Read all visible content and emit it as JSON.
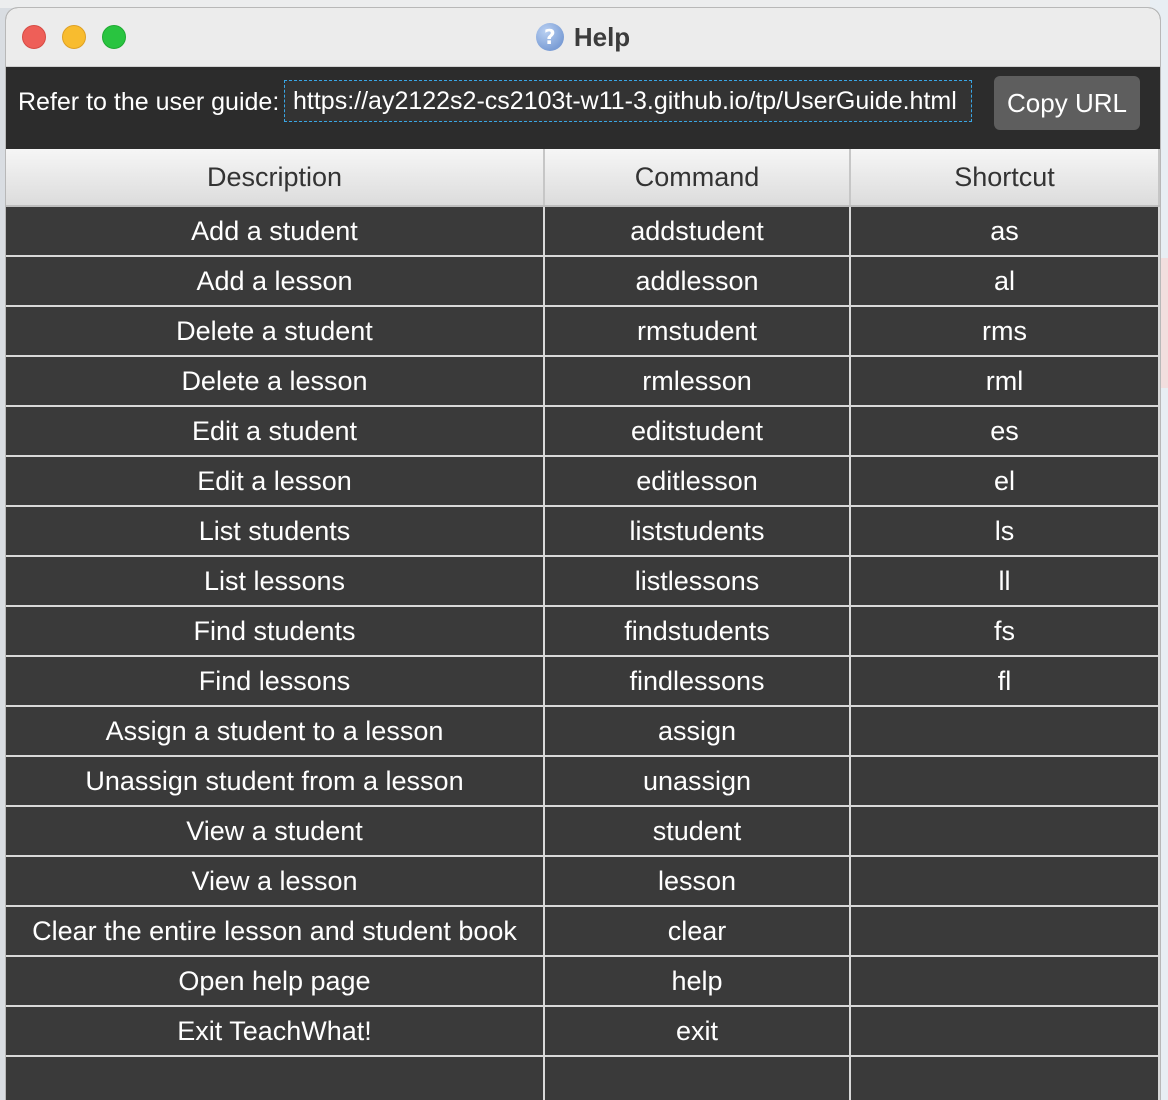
{
  "window": {
    "title": "Help",
    "icon": "question-mark-icon"
  },
  "toolbar": {
    "guide_label": "Refer to the user guide:",
    "url": "https://ay2122s2-cs2103t-w11-3.github.io/tp/UserGuide.html",
    "copy_button_label": "Copy URL"
  },
  "table": {
    "columns": [
      "Description",
      "Command",
      "Shortcut"
    ],
    "rows": [
      {
        "description": "Add a student",
        "command": "addstudent",
        "shortcut": "as"
      },
      {
        "description": "Add a lesson",
        "command": "addlesson",
        "shortcut": "al"
      },
      {
        "description": "Delete a student",
        "command": "rmstudent",
        "shortcut": "rms"
      },
      {
        "description": "Delete a lesson",
        "command": "rmlesson",
        "shortcut": "rml"
      },
      {
        "description": "Edit a student",
        "command": "editstudent",
        "shortcut": "es"
      },
      {
        "description": "Edit a lesson",
        "command": "editlesson",
        "shortcut": "el"
      },
      {
        "description": "List students",
        "command": "liststudents",
        "shortcut": "ls"
      },
      {
        "description": "List lessons",
        "command": "listlessons",
        "shortcut": "ll"
      },
      {
        "description": "Find students",
        "command": "findstudents",
        "shortcut": "fs"
      },
      {
        "description": "Find lessons",
        "command": "findlessons",
        "shortcut": "fl"
      },
      {
        "description": "Assign a student to a lesson",
        "command": "assign",
        "shortcut": ""
      },
      {
        "description": "Unassign student from a lesson",
        "command": "unassign",
        "shortcut": ""
      },
      {
        "description": "View a student",
        "command": "student",
        "shortcut": ""
      },
      {
        "description": "View a lesson",
        "command": "lesson",
        "shortcut": ""
      },
      {
        "description": "Clear the entire lesson and student book",
        "command": "clear",
        "shortcut": ""
      },
      {
        "description": "Open help page",
        "command": "help",
        "shortcut": ""
      },
      {
        "description": "Exit TeachWhat!",
        "command": "exit",
        "shortcut": ""
      }
    ]
  }
}
